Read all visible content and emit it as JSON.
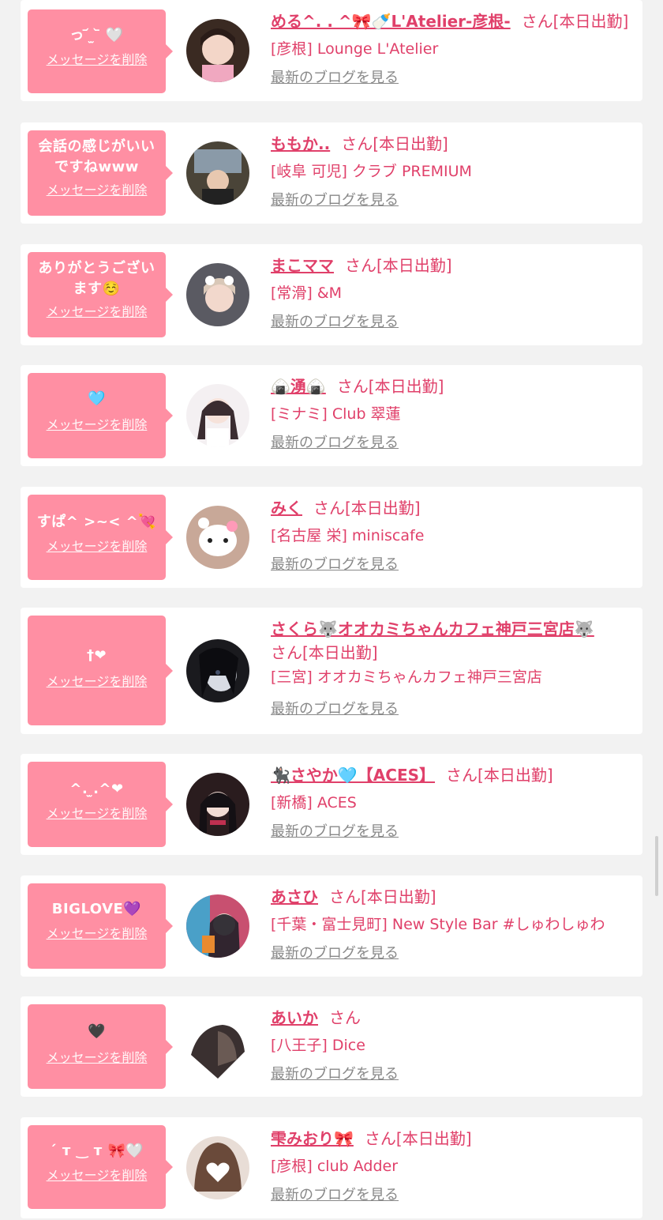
{
  "common": {
    "delete_label": "メッセージを削除",
    "blog_label": "最新のブログを見る"
  },
  "entries": [
    {
      "message": "っ ᷄ ̫ ᷅ 🤍",
      "name": "める^. . ^🎀🍼L'Atelier-彦根-",
      "san": "さん[本日出勤]",
      "shop": "[彦根] Lounge L'Atelier"
    },
    {
      "message": "会話の感じがいいですねwww",
      "name": "ももか..",
      "san": "さん[本日出勤]",
      "shop": "[岐阜 可児] クラブ PREMIUM"
    },
    {
      "message": "ありがとうございます☺️",
      "name": "まこママ",
      "san": "さん[本日出勤]",
      "shop": "[常滑] &M"
    },
    {
      "message": "🩵",
      "name": "🍙湧🍙",
      "san": "さん[本日出勤]",
      "shop": "[ミナミ] Club 翠蓮"
    },
    {
      "message": "すぱ^ >~< ^💘",
      "name": "みく",
      "san": "さん[本日出勤]",
      "shop": "[名古屋 栄] miniscafe"
    },
    {
      "message": "†❤",
      "name": "さくら🐺オオカミちゃんカフェ神戸三宮店🐺",
      "san": "さん[本日出勤]",
      "shop": "[三宮] オオカミちゃんカフェ神戸三宮店"
    },
    {
      "message": "^.  ̫.^❤",
      "name": "🐈‍⬛さやか🩵【ACES】",
      "san": "さん[本日出勤]",
      "shop": "[新橋] ACES"
    },
    {
      "message": "BIGLOVE💜",
      "name": "あさひ",
      "san": "さん[本日出勤]",
      "shop": "[千葉・富士見町] New Style Bar #しゅわしゅわ"
    },
    {
      "message": "🖤",
      "name": "あいか",
      "san": "さん",
      "shop": "[八王子] Dice"
    },
    {
      "message": "´ т ‿ т 🎀🤍",
      "name": "雫みおり🎀",
      "san": "さん[本日出勤]",
      "shop": "[彦根] club Adder"
    }
  ],
  "colors": {
    "accent": "#e0406a",
    "bubble": "#ff8fa3",
    "background": "#f2f2f2"
  }
}
